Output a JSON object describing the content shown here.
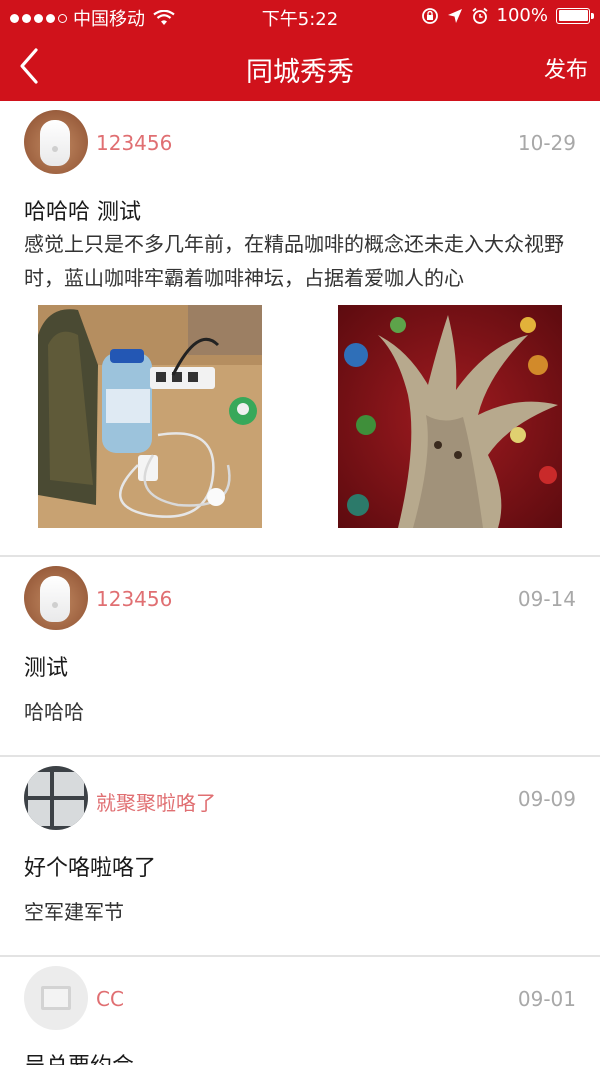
{
  "status_bar": {
    "carrier": "中国移动",
    "time": "下午5:22",
    "battery": "100%"
  },
  "nav": {
    "title": "同城秀秀",
    "publish_label": "发布"
  },
  "posts": [
    {
      "author": "123456",
      "date": "10-29",
      "title": "哈哈哈 测试",
      "body": "感觉上只是不多几年前，在精品咖啡的概念还未走入大众视野时，蓝山咖啡牢霸着咖啡神坛，占据着爱咖人的心",
      "images": [
        "desk-cables-photo",
        "fantasy-tree-illustration"
      ]
    },
    {
      "author": "123456",
      "date": "09-14",
      "title": "测试",
      "body": "哈哈哈"
    },
    {
      "author": "就聚聚啦咯了",
      "date": "09-09",
      "title": "好个咯啦咯了",
      "body": "空军建军节"
    },
    {
      "author": "CC",
      "date": "09-01",
      "title": "吴总要约会"
    }
  ],
  "colors": {
    "brand_red": "#d0121b",
    "author_pink": "#e06f72",
    "date_gray": "#a8a8a8"
  }
}
